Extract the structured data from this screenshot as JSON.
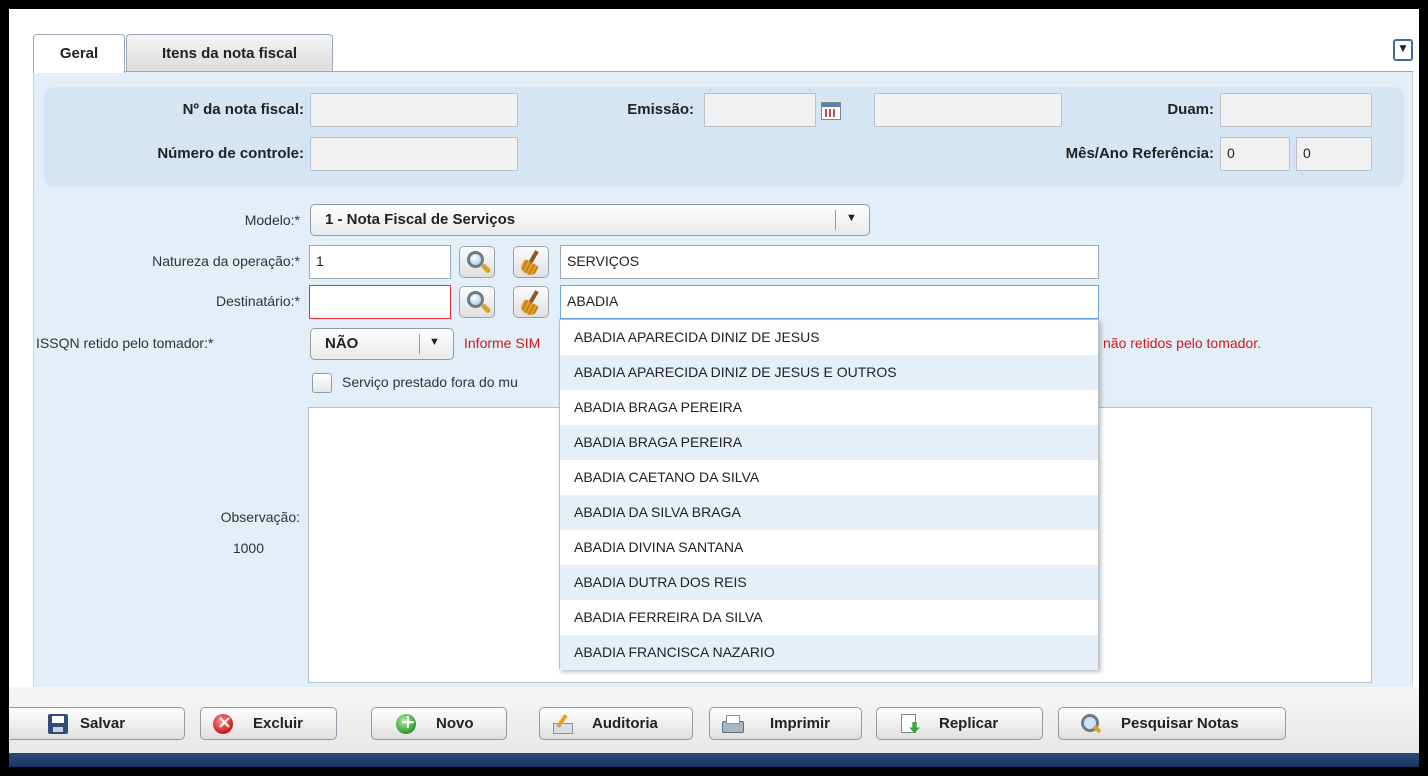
{
  "tabs": [
    {
      "label": "Geral",
      "active": true
    },
    {
      "label": "Itens da nota fiscal",
      "active": false
    }
  ],
  "header": {
    "nota_label": "Nº da nota fiscal:",
    "nota_value": "",
    "emissao_label": "Emissão:",
    "emissao_value": "",
    "emissao_extra_value": "",
    "duam_label": "Duam:",
    "duam_value": "",
    "controle_label": "Número de controle:",
    "controle_value": "",
    "mes_ano_label": "Mês/Ano Referência:",
    "mes_value": "0",
    "ano_value": "0"
  },
  "form": {
    "modelo_label": "Modelo:*",
    "modelo_value": "1 - Nota Fiscal de Serviços",
    "natureza_label": "Natureza da operação:*",
    "natureza_code": "1",
    "natureza_desc": "SERVIÇOS",
    "destinatario_label": "Destinatário:*",
    "destinatario_code": "",
    "destinatario_search": "ABADIA",
    "issqn_label": "ISSQN retido pelo tomador:*",
    "issqn_value": "NÃO",
    "issqn_warning_left": "Informe SIM",
    "issqn_warning_right": "l não retidos pelo tomador.",
    "servico_fora_label": "Serviço prestado fora do mu",
    "servico_fora_checked": false,
    "observacao_label": "Observação:",
    "observacao_counter": "1000",
    "observacao_value": ""
  },
  "dropdown": {
    "items": [
      "ABADIA APARECIDA DINIZ DE JESUS",
      "ABADIA APARECIDA DINIZ DE JESUS E OUTROS",
      "ABADIA BRAGA PEREIRA",
      "ABADIA BRAGA PEREIRA",
      "ABADIA CAETANO DA SILVA",
      "ABADIA DA SILVA BRAGA",
      "ABADIA DIVINA SANTANA",
      "ABADIA DUTRA DOS REIS",
      "ABADIA FERREIRA DA SILVA",
      "ABADIA FRANCISCA NAZARIO"
    ]
  },
  "footer": {
    "salvar": "Salvar",
    "excluir": "Excluir",
    "novo": "Novo",
    "auditoria": "Auditoria",
    "imprimir": "Imprimir",
    "replicar": "Replicar",
    "pesquisar": "Pesquisar Notas"
  },
  "icons": {
    "collapse": "chevron-down-icon",
    "calendar": "calendar-icon",
    "search": "magnifier-icon",
    "clear": "broom-icon",
    "save": "floppy-disk-icon",
    "delete": "red-x-icon",
    "new": "green-plus-icon",
    "audit": "audit-icon",
    "print": "printer-icon",
    "replicate": "replicate-icon"
  },
  "colors": {
    "panel_bg": "#e3eef8",
    "header_panel_bg": "#d5e5f4",
    "warning_text": "#d21a1a",
    "error_border": "#e03030",
    "dropdown_alt_row": "#e6eff8"
  }
}
